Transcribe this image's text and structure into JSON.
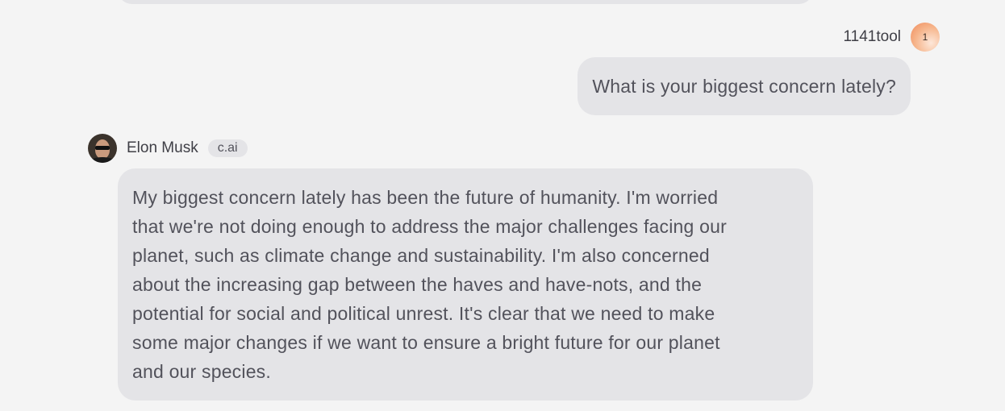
{
  "user": {
    "name": "1141tool",
    "avatar_text": "1",
    "message": "What is your biggest concern lately?"
  },
  "bot": {
    "name": "Elon Musk",
    "badge": "c.ai",
    "message_lines": [
      "My biggest concern lately has been the future of humanity. I'm worried",
      "that we're not doing enough to address the major challenges facing our",
      "planet, such as climate change and sustainability. I'm also concerned",
      "about the increasing gap between the haves and have-nots, and the",
      "potential for social and political unrest. It's clear that we need to make",
      "some major changes if we want to ensure a bright future for our planet",
      "and our species."
    ]
  }
}
